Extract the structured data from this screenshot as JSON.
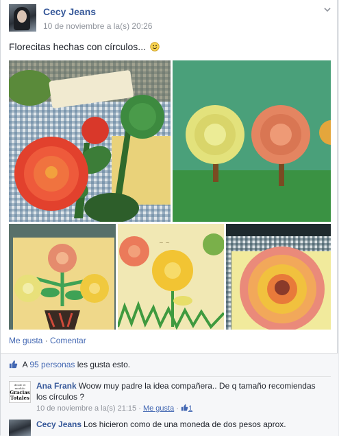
{
  "post": {
    "author": "Cecy Jeans",
    "timestamp": "10 de noviembre a la(s) 20:26",
    "text": "Florecitas hechas con círculos...",
    "emoji": "smiley"
  },
  "photos": [
    {
      "name": "photo-red-flowers"
    },
    {
      "name": "photo-lollipop-trees"
    },
    {
      "name": "photo-flower-pot"
    },
    {
      "name": "photo-yellow-flowers"
    },
    {
      "name": "photo-orange-flower"
    }
  ],
  "actions": {
    "like_label": "Me gusta",
    "separator": " · ",
    "comment_label": "Comentar"
  },
  "likes": {
    "prefix": "A ",
    "link": "95 personas",
    "suffix": " les gusta esto."
  },
  "comments": [
    {
      "author": "Ana Frank",
      "avatar_text_top": "Gracias",
      "avatar_text_bottom": "Totales",
      "text": "Woow muy padre la idea compañera.. De q tamaño recomiendas los círculos ?",
      "timestamp": "10 de noviembre a la(s) 21:15",
      "separator": " · ",
      "like_label": "Me gusta",
      "like_count": "1"
    },
    {
      "author": "Cecy Jeans",
      "text": "Los hicieron como de una moneda de dos pesos aprox."
    }
  ],
  "colors": {
    "link": "#365899",
    "background": "#e9ebee",
    "meta": "#90949c"
  }
}
